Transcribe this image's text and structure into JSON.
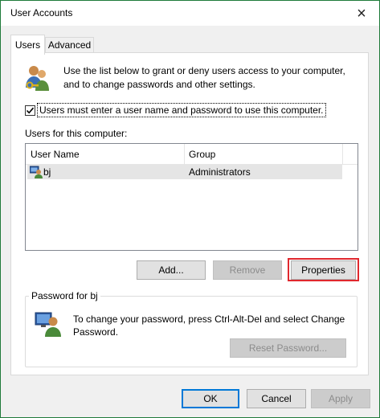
{
  "window": {
    "title": "User Accounts",
    "close_glyph": "×"
  },
  "tabs": [
    {
      "label": "Users",
      "active": true
    },
    {
      "label": "Advanced",
      "active": false
    }
  ],
  "intro": {
    "icon": "users-keys-icon",
    "text": "Use the list below to grant or deny users access to your computer, and to change passwords and other settings."
  },
  "checkbox": {
    "checked": true,
    "label": "Users must enter a user name and password to use this computer."
  },
  "users_section": {
    "label": "Users for this computer:",
    "columns": [
      "User Name",
      "Group"
    ],
    "rows": [
      {
        "icon": "user-icon",
        "user_name": "bj",
        "group": "Administrators",
        "selected": true
      }
    ]
  },
  "buttons": {
    "add": "Add...",
    "remove": "Remove",
    "properties": "Properties"
  },
  "password_group": {
    "legend": "Password for bj",
    "text": "To change your password, press Ctrl-Alt-Del and select Change Password.",
    "reset_button": "Reset Password..."
  },
  "footer": {
    "ok": "OK",
    "cancel": "Cancel",
    "apply": "Apply"
  },
  "colors": {
    "window_border": "#1f7a3a",
    "highlight": "#e0282e",
    "default_button_border": "#0078d7"
  }
}
